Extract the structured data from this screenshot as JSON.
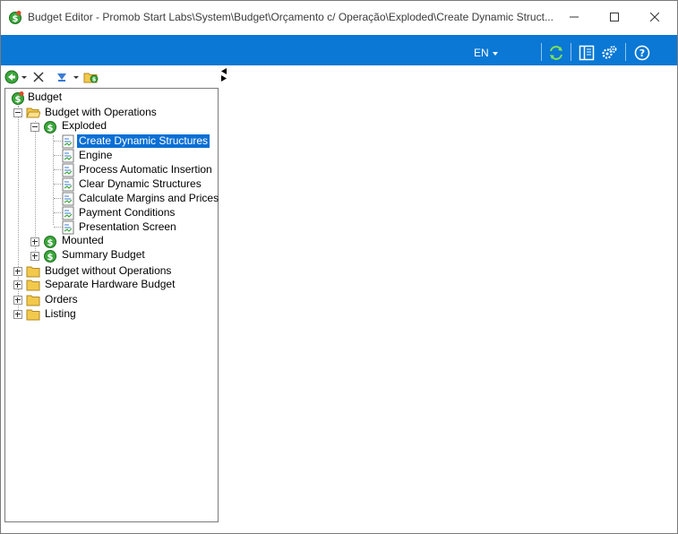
{
  "window": {
    "title": "Budget Editor - Promob Start Labs\\System\\Budget\\Orçamento c/ Operação\\Exploded\\Create Dynamic Struct...",
    "minimize": "minimize",
    "maximize": "maximize",
    "close": "close"
  },
  "toolbar": {
    "language": "EN",
    "accent": "#0a78d4"
  },
  "tree": {
    "root": "Budget",
    "with_operations": "Budget with Operations",
    "exploded": "Exploded",
    "items": [
      "Create Dynamic Structures",
      "Engine",
      "Process Automatic Insertion",
      "Clear Dynamic Structures",
      "Calculate Margins and Prices",
      "Payment Conditions",
      "Presentation Screen"
    ],
    "mounted": "Mounted",
    "summary": "Summary Budget",
    "without_operations": "Budget without Operations",
    "hardware": "Separate Hardware Budget",
    "orders": "Orders",
    "listing": "Listing"
  }
}
